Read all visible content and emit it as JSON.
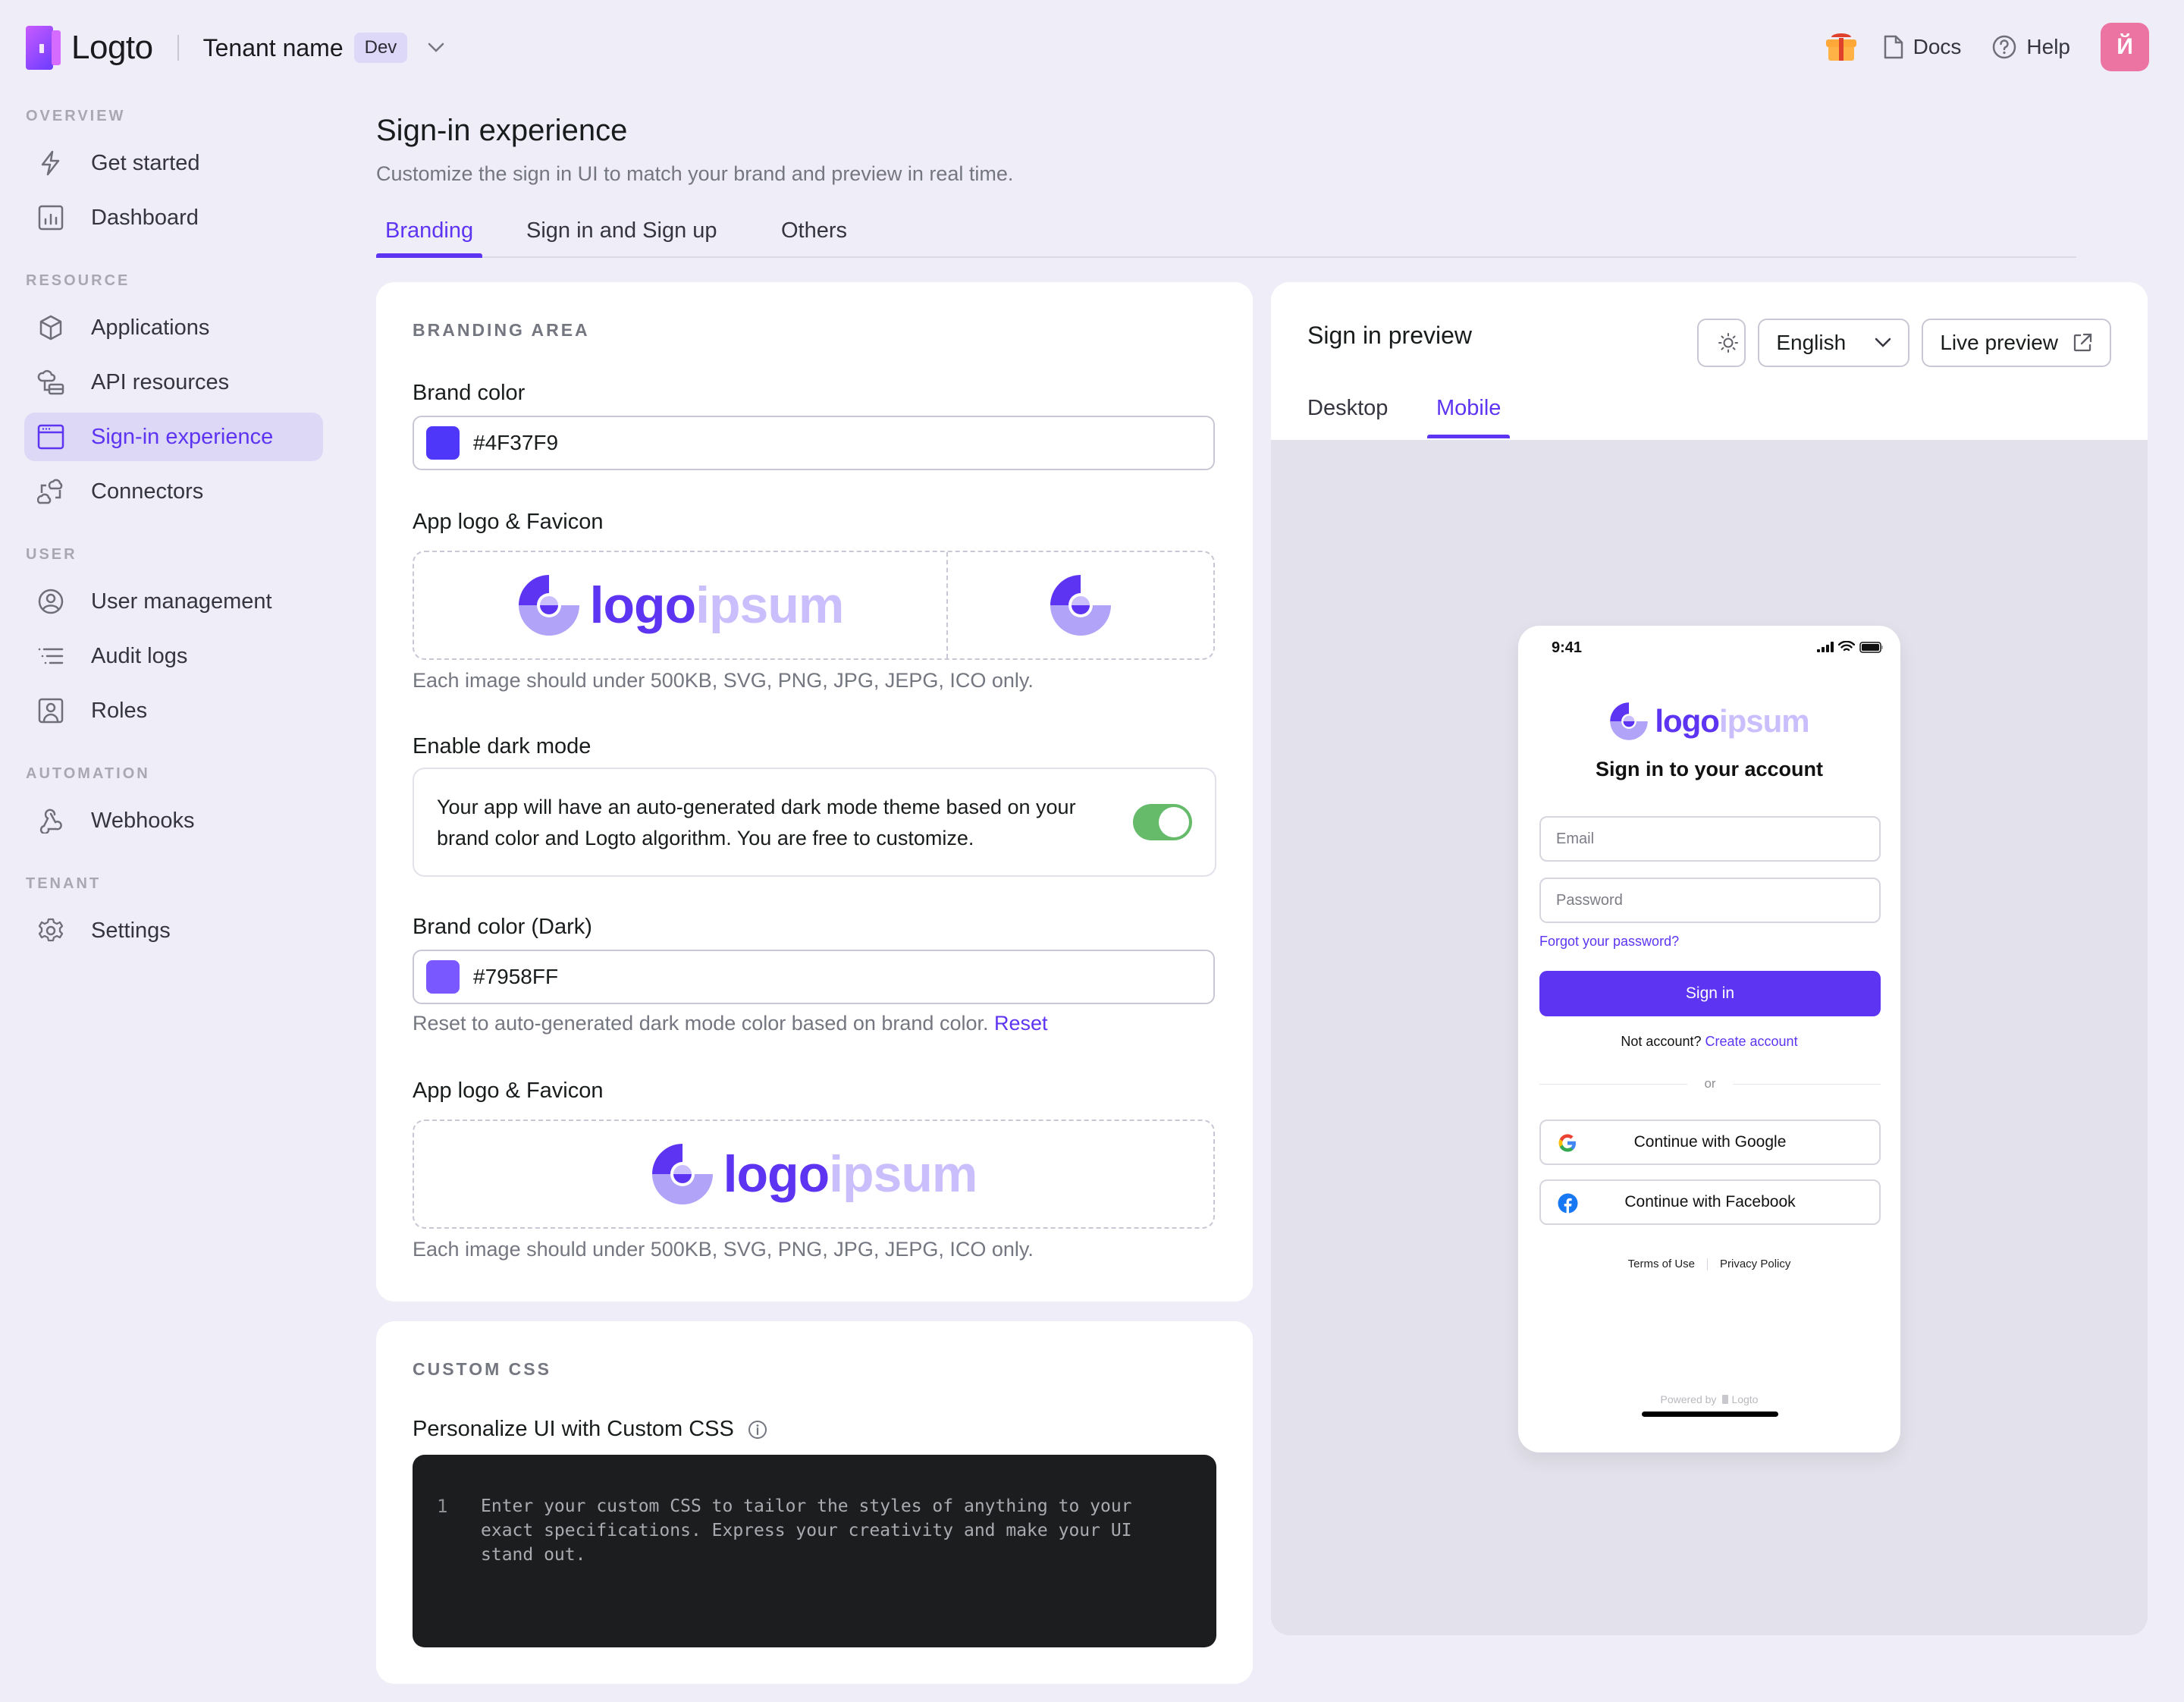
{
  "app": {
    "brand_name": "Logto",
    "tenant_name": "Tenant name",
    "tenant_env_badge": "Dev",
    "top_actions": {
      "gift_icon": "gift-icon",
      "docs_label": "Docs",
      "help_label": "Help",
      "avatar_initial": "Й"
    }
  },
  "sidebar": {
    "sections": [
      {
        "title": "OVERVIEW",
        "items": [
          {
            "label": "Get started",
            "icon": "lightning-icon"
          },
          {
            "label": "Dashboard",
            "icon": "chart-icon"
          }
        ]
      },
      {
        "title": "RESOURCE",
        "items": [
          {
            "label": "Applications",
            "icon": "cube-icon"
          },
          {
            "label": "API resources",
            "icon": "cloud-database-icon"
          },
          {
            "label": "Sign-in experience",
            "icon": "browser-window-icon",
            "active": true
          },
          {
            "label": "Connectors",
            "icon": "connectors-icon"
          }
        ]
      },
      {
        "title": "USER",
        "items": [
          {
            "label": "User management",
            "icon": "user-circle-icon"
          },
          {
            "label": "Audit logs",
            "icon": "list-icon"
          },
          {
            "label": "Roles",
            "icon": "user-badge-icon"
          }
        ]
      },
      {
        "title": "AUTOMATION",
        "items": [
          {
            "label": "Webhooks",
            "icon": "webhook-icon"
          }
        ]
      },
      {
        "title": "TENANT",
        "items": [
          {
            "label": "Settings",
            "icon": "gear-icon"
          }
        ]
      }
    ]
  },
  "page": {
    "title": "Sign-in experience",
    "subtitle": "Customize the sign in UI to match your brand and preview in real time.",
    "tabs": [
      {
        "label": "Branding",
        "active": true
      },
      {
        "label": "Sign in and Sign up",
        "active": false
      },
      {
        "label": "Others",
        "active": false
      }
    ]
  },
  "branding": {
    "section_title": "BRANDING AREA",
    "brand_color_label": "Brand color",
    "brand_color_value": "#4F37F9",
    "app_logo_label": "App logo & Favicon",
    "logo_word_primary": "logo",
    "logo_word_secondary": "ipsum",
    "upload_help": "Each image should under 500KB, SVG, PNG, JPG, JEPG, ICO only.",
    "dark_mode_label": "Enable dark mode",
    "dark_mode_description": "Your app will have an auto-generated dark mode theme based on your brand color and Logto algorithm. You are free to customize.",
    "dark_mode_enabled": true,
    "brand_color_dark_label": "Brand color (Dark)",
    "brand_color_dark_value": "#7958FF",
    "reset_help": "Reset to auto-generated dark mode color based on brand color.",
    "reset_link": "Reset",
    "dark_app_logo_label": "App logo & Favicon",
    "dark_upload_help": "Each image should under 500KB, SVG, PNG, JPG, JEPG, ICO only."
  },
  "custom_css": {
    "section_title": "CUSTOM CSS",
    "label": "Personalize UI with Custom CSS",
    "line_number": "1",
    "placeholder": "Enter your custom CSS to tailor the styles of anything to your exact specifications. Express your creativity and make your UI stand out."
  },
  "preview": {
    "title": "Sign in preview",
    "language": "English",
    "live_preview_label": "Live preview",
    "tabs": [
      {
        "label": "Desktop",
        "active": false
      },
      {
        "label": "Mobile",
        "active": true
      }
    ],
    "phone": {
      "time": "9:41",
      "logo_word_primary": "logo",
      "logo_word_secondary": "ipsum",
      "heading": "Sign in to your account",
      "email_placeholder": "Email",
      "password_placeholder": "Password",
      "forgot_password": "Forgot your password?",
      "sign_in_button": "Sign in",
      "no_account_text": "Not account?",
      "create_account_link": "Create account",
      "divider_text": "or",
      "social_buttons": [
        {
          "label": "Continue with Google",
          "icon": "google-icon"
        },
        {
          "label": "Continue with Facebook",
          "icon": "facebook-icon"
        }
      ],
      "terms_link": "Terms of Use",
      "privacy_link": "Privacy Policy",
      "powered_by": "Powered by",
      "powered_brand": "Logto"
    }
  },
  "colors": {
    "accent": "#5D34F2",
    "brand": "#4F37F9",
    "brand_dark": "#7958FF",
    "toggle_on": "#66BB6A",
    "avatar": "#EC74A3"
  }
}
